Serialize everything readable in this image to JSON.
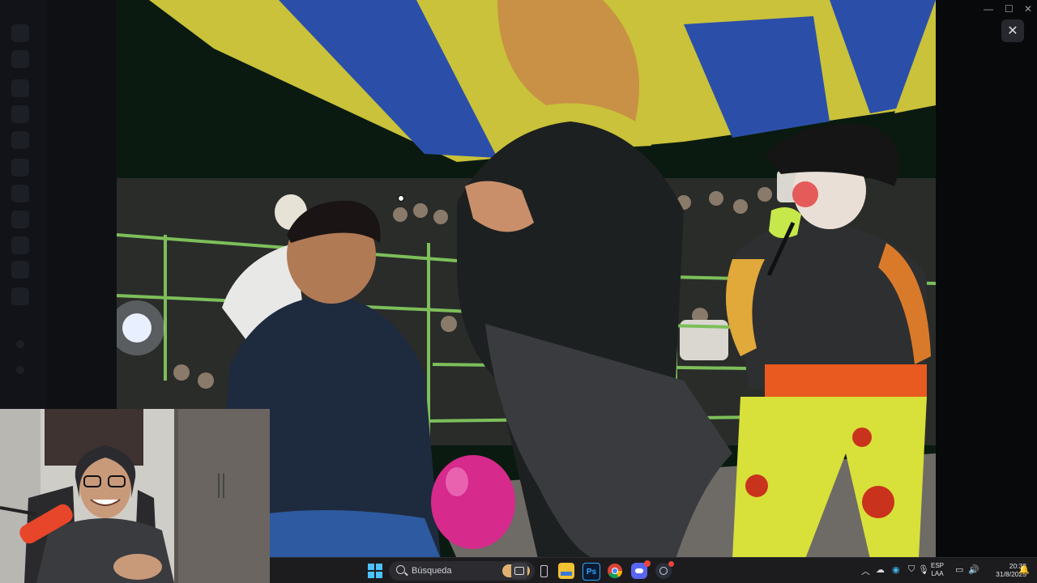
{
  "taskbar": {
    "search_label": "Búsqueda",
    "apps": [
      {
        "name": "windows-start-icon",
        "label": ""
      },
      {
        "name": "search-bar",
        "label": "Búsqueda"
      },
      {
        "name": "task-view-icon",
        "label": ""
      },
      {
        "name": "phone-icon",
        "label": ""
      },
      {
        "name": "file-explorer-icon",
        "label": ""
      },
      {
        "name": "photoshop-icon",
        "label": "Ps"
      },
      {
        "name": "chrome-icon",
        "label": ""
      },
      {
        "name": "discord-icon",
        "label": ""
      },
      {
        "name": "steam-icon",
        "label": ""
      }
    ],
    "tray": {
      "language_top": "ESP",
      "language_bottom": "LAA",
      "time": "20:38",
      "date": "31/8/2025"
    }
  },
  "viewer": {
    "close_glyph": "✕",
    "minimize_glyph": "—",
    "maximize_glyph": "☐",
    "window_close_glyph": "✕"
  },
  "colors": {
    "taskbar_bg": "#1c1c1f",
    "tent_yellow": "#c9c23a",
    "tent_blue": "#2b4fa8",
    "railing_green": "#7dbf5a",
    "balloon_pink": "#d62a8c"
  }
}
